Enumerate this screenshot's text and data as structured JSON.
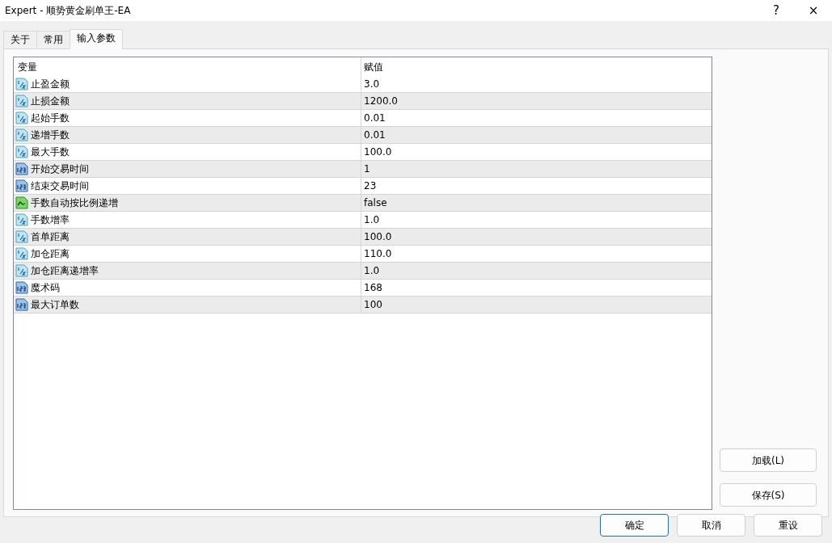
{
  "window": {
    "title": "Expert - 顺势黄金刷单王-EA",
    "help": "?",
    "close": "×"
  },
  "tabs": [
    {
      "label": "关于",
      "selected": false
    },
    {
      "label": "常用",
      "selected": false
    },
    {
      "label": "输入参数",
      "selected": true
    }
  ],
  "table": {
    "columns": [
      "变量",
      "赋值"
    ],
    "rows": [
      {
        "kind": "double",
        "name": "止盈金额",
        "value": "3.0"
      },
      {
        "kind": "double",
        "name": "止损金额",
        "value": "1200.0"
      },
      {
        "kind": "double",
        "name": "起始手数",
        "value": "0.01"
      },
      {
        "kind": "double",
        "name": "递增手数",
        "value": "0.01"
      },
      {
        "kind": "double",
        "name": "最大手数",
        "value": "100.0"
      },
      {
        "kind": "int",
        "name": "开始交易时间",
        "value": "1"
      },
      {
        "kind": "int",
        "name": "结束交易时间",
        "value": "23"
      },
      {
        "kind": "bool",
        "name": "手数自动按比例递增",
        "value": "false"
      },
      {
        "kind": "double",
        "name": "手数增率",
        "value": "1.0"
      },
      {
        "kind": "double",
        "name": "首单距离",
        "value": "100.0"
      },
      {
        "kind": "double",
        "name": "加仓距离",
        "value": "110.0"
      },
      {
        "kind": "double",
        "name": "加仓距离递增率",
        "value": "1.0"
      },
      {
        "kind": "int",
        "name": "魔术码",
        "value": "168"
      },
      {
        "kind": "int",
        "name": "最大订单数",
        "value": "100"
      }
    ]
  },
  "side_buttons": [
    "加载(L)",
    "保存(S)"
  ],
  "footer_buttons": [
    "确定",
    "取消",
    "重设"
  ]
}
